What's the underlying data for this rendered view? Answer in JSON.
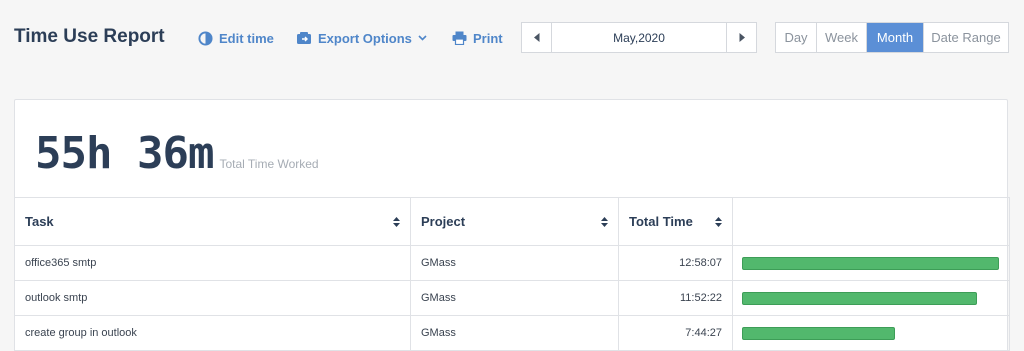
{
  "header": {
    "title": "Time Use Report",
    "edit_time": "Edit time",
    "export_options": "Export Options",
    "print": "Print"
  },
  "date_nav": {
    "label": "May,2020"
  },
  "ranges": [
    {
      "label": "Day",
      "active": false
    },
    {
      "label": "Week",
      "active": false
    },
    {
      "label": "Month",
      "active": true
    },
    {
      "label": "Date Range",
      "active": false
    }
  ],
  "summary": {
    "total": "55h 36m",
    "label": "Total Time Worked"
  },
  "table": {
    "columns": [
      "Task",
      "Project",
      "Total Time",
      ""
    ],
    "rows": [
      {
        "task": "office365 smtp",
        "project": "GMass",
        "total": "12:58:07",
        "fraction": 1.0
      },
      {
        "task": "outlook smtp",
        "project": "GMass",
        "total": "11:52:22",
        "fraction": 0.915
      },
      {
        "task": "create group in outlook",
        "project": "GMass",
        "total": "7:44:27",
        "fraction": 0.597
      }
    ]
  },
  "colors": {
    "accent": "#5b8fd6",
    "link": "#4f86c9",
    "bar": "#52b86d"
  }
}
